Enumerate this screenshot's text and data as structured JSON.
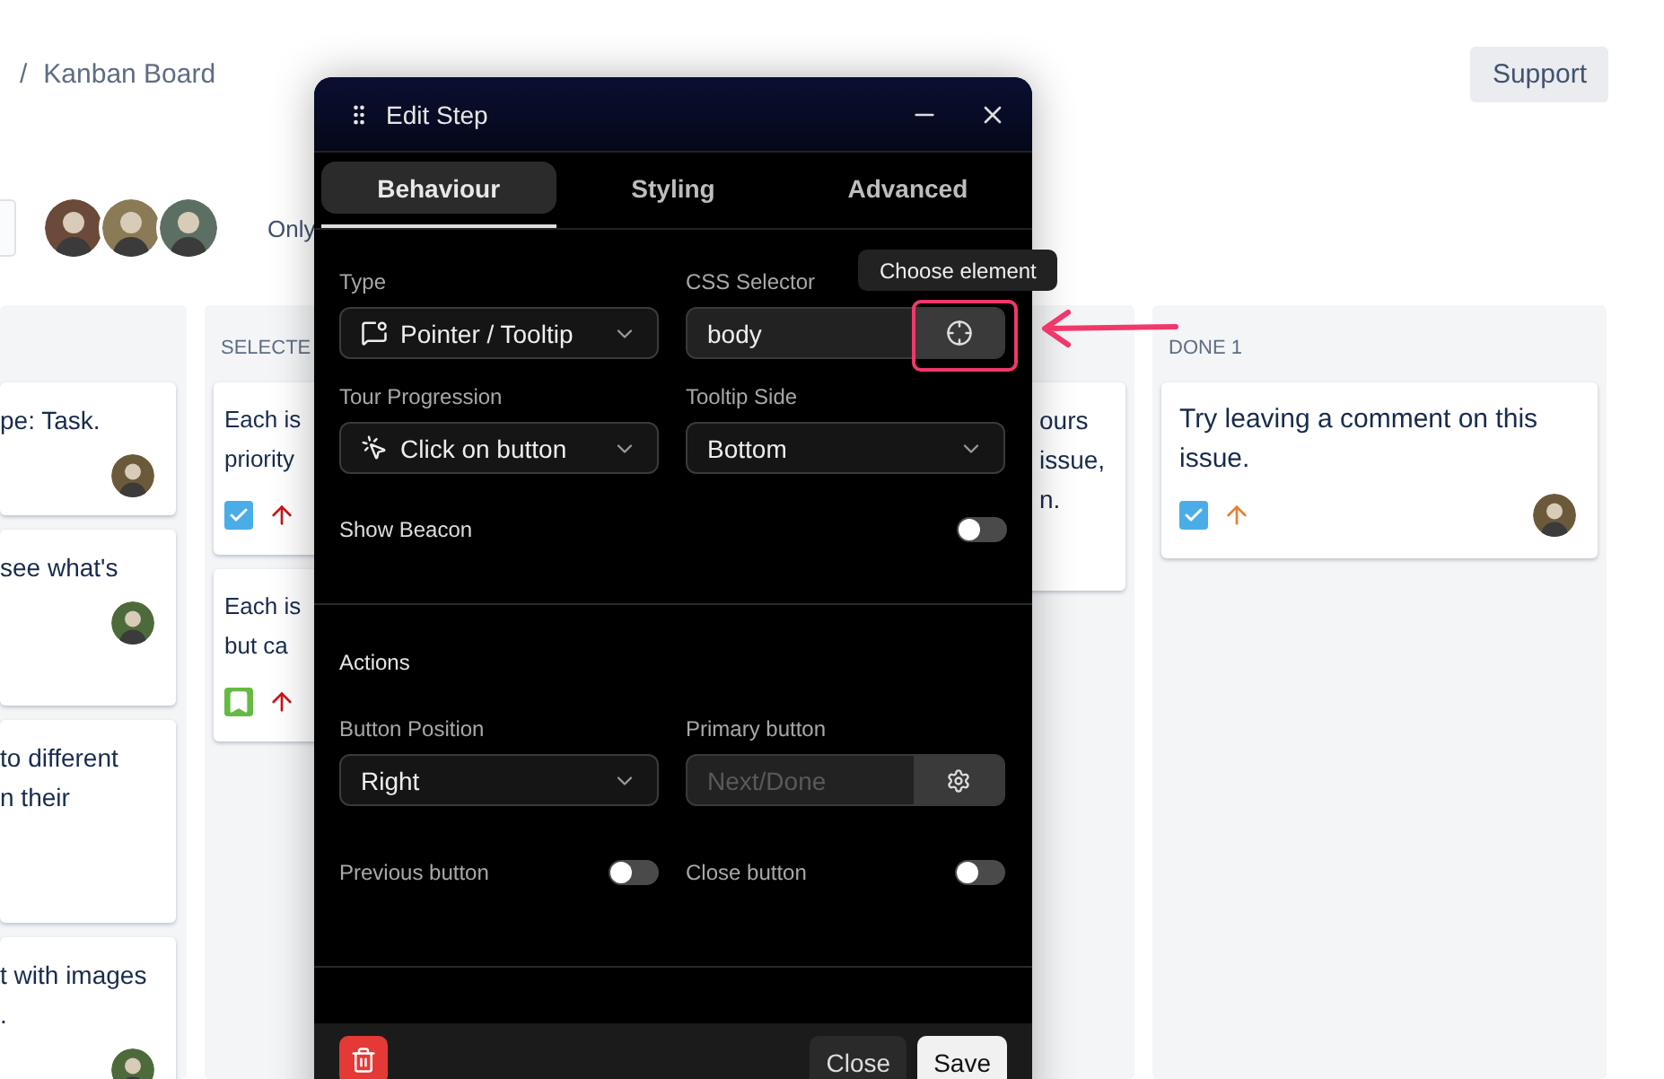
{
  "breadcrumb": {
    "separator": "/",
    "current": "Kanban Board"
  },
  "support_button": "Support",
  "filter": {
    "only_label": "Only"
  },
  "columns": [
    {
      "cards": [
        {
          "lines": [
            "pe: Task."
          ],
          "assignee": true
        },
        {
          "lines": [
            "see what's"
          ],
          "assignee": true
        },
        {
          "lines": [
            "to different",
            "n their"
          ],
          "assignee": false
        },
        {
          "lines": [
            "t with images",
            "."
          ],
          "assignee": true
        }
      ]
    },
    {
      "title": "SELECTE",
      "cards": [
        {
          "lines": [
            "Each is",
            "priority"
          ],
          "kind": "task",
          "color": "#cd1317",
          "assignee": false
        },
        {
          "lines": [
            "Each is",
            "but ca"
          ],
          "kind": "story",
          "color": "#cd1317",
          "assignee": false
        }
      ]
    },
    {
      "cards": [
        {
          "lines": [
            "ours",
            "issue,",
            "n."
          ],
          "assignee": false
        }
      ]
    },
    {
      "title": "DONE 1",
      "cards": [
        {
          "lines": [
            "Try leaving a comment on this",
            "issue."
          ],
          "kind": "task",
          "color": "#e97f33",
          "assignee": true
        }
      ]
    }
  ],
  "dialog": {
    "title": "Edit Step",
    "tabs": [
      {
        "label": "Behaviour",
        "selected": true
      },
      {
        "label": "Styling",
        "selected": false
      },
      {
        "label": "Advanced",
        "selected": false
      }
    ],
    "type_field": {
      "label": "Type",
      "value": "Pointer / Tooltip"
    },
    "css_selector": {
      "label": "CSS Selector",
      "value": "body",
      "tooltip": "Choose element"
    },
    "tour_progression": {
      "label": "Tour Progression",
      "value": "Click on button"
    },
    "tooltip_side": {
      "label": "Tooltip Side",
      "value": "Bottom"
    },
    "show_beacon": {
      "label": "Show Beacon",
      "on": false
    },
    "actions_heading": "Actions",
    "button_position": {
      "label": "Button Position",
      "value": "Right"
    },
    "primary_button": {
      "label": "Primary button",
      "placeholder": "Next/Done"
    },
    "previous_button": {
      "label": "Previous button",
      "on": false
    },
    "close_button": {
      "label": "Close button",
      "on": false
    },
    "footer": {
      "close": "Close",
      "save": "Save"
    }
  }
}
